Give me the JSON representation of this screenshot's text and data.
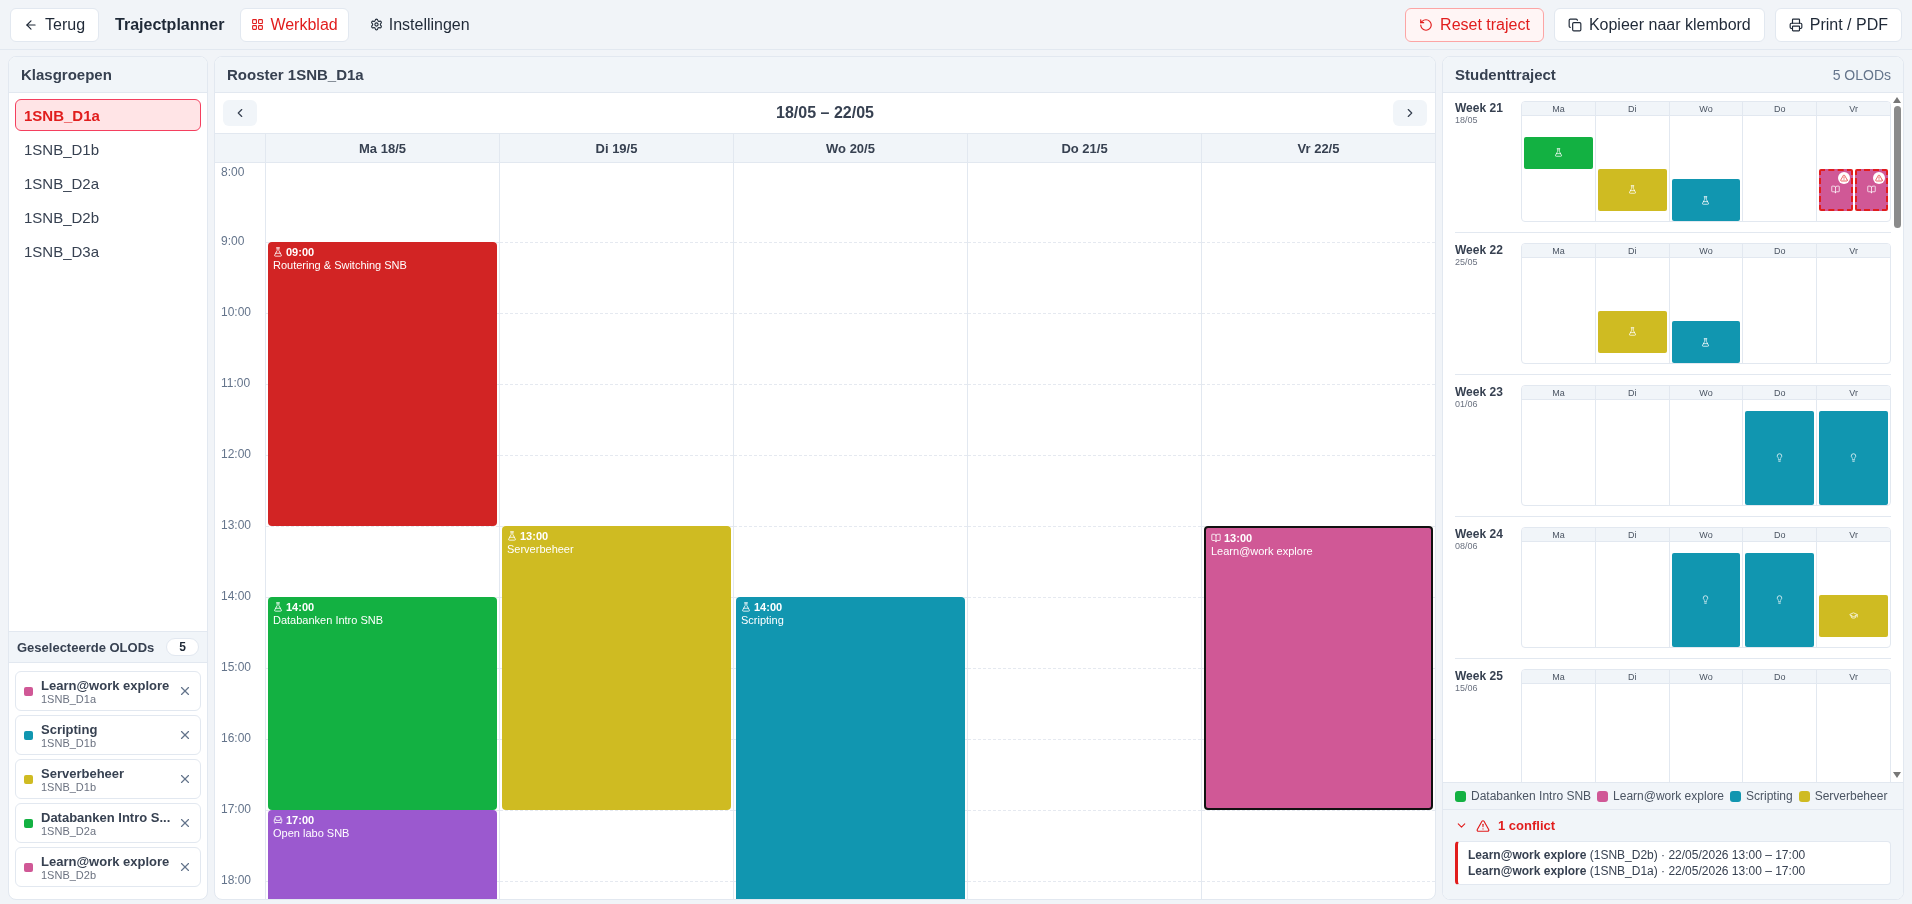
{
  "toolbar": {
    "back": "Terug",
    "title": "Trajectplanner",
    "tabs": [
      {
        "label": "Werkblad",
        "selected": true,
        "kind": "grid"
      },
      {
        "label": "Instellingen",
        "selected": false,
        "kind": "gear"
      }
    ],
    "actions": [
      {
        "label": "Reset traject",
        "kind": "reset"
      },
      {
        "label": "Kopieer naar klembord",
        "kind": "copy"
      },
      {
        "label": "Print / PDF",
        "kind": "print"
      }
    ]
  },
  "groups": {
    "title": "Klasgroepen",
    "items": [
      {
        "label": "1SNB_D1a",
        "selected": true
      },
      {
        "label": "1SNB_D1b",
        "selected": false
      },
      {
        "label": "1SNB_D2a",
        "selected": false
      },
      {
        "label": "1SNB_D2b",
        "selected": false
      },
      {
        "label": "1SNB_D3a",
        "selected": false
      }
    ]
  },
  "selected_olods": {
    "title": "Geselecteerde OLODs",
    "count": "5",
    "items": [
      {
        "name": "Learn@work explore",
        "group": "1SNB_D1a",
        "color": "#d05896"
      },
      {
        "name": "Scripting",
        "group": "1SNB_D1b",
        "color": "#1196b0"
      },
      {
        "name": "Serverbeheer",
        "group": "1SNB_D1b",
        "color": "#cfbb22"
      },
      {
        "name": "Databanken Intro S...",
        "group": "1SNB_D2a",
        "color": "#13b142"
      },
      {
        "name": "Learn@work explore",
        "group": "1SNB_D2b",
        "color": "#d05896"
      }
    ]
  },
  "schedule": {
    "title": "Rooster 1SNB_D1a",
    "range": "18/05 – 22/05",
    "hours": [
      "8:00",
      "9:00",
      "10:00",
      "11:00",
      "12:00",
      "13:00",
      "14:00",
      "15:00",
      "16:00",
      "17:00",
      "18:00"
    ],
    "days": [
      {
        "label": "Ma 18/5",
        "slots": [
          {
            "kind": "empty"
          },
          {
            "kind": "lab",
            "time": "09:00",
            "title": "Routering & Switching SNB",
            "color": "#d22424",
            "selected": false
          },
          {
            "kind": "cont"
          },
          {
            "kind": "cont"
          },
          {
            "kind": "cont"
          },
          {
            "kind": "empty"
          },
          {
            "kind": "lab",
            "time": "14:00",
            "title": "Databanken Intro SNB",
            "color": "#13b142",
            "selected": false
          },
          {
            "kind": "cont"
          },
          {
            "kind": "cont"
          },
          {
            "kind": "chair",
            "time": "17:00",
            "title": "Open labo SNB",
            "color": "#9b59cf",
            "selected": false
          },
          {
            "kind": "cont"
          }
        ]
      },
      {
        "label": "Di 19/5",
        "slots": [
          {
            "kind": "empty"
          },
          {
            "kind": "empty"
          },
          {
            "kind": "empty"
          },
          {
            "kind": "empty"
          },
          {
            "kind": "empty"
          },
          {
            "kind": "lab",
            "time": "13:00",
            "title": "Serverbeheer",
            "color": "#cfbb22",
            "selected": false
          },
          {
            "kind": "cont"
          },
          {
            "kind": "cont"
          },
          {
            "kind": "cont"
          }
        ]
      },
      {
        "label": "Wo 20/5",
        "slots": [
          {
            "kind": "empty"
          },
          {
            "kind": "empty"
          },
          {
            "kind": "empty"
          },
          {
            "kind": "empty"
          },
          {
            "kind": "empty"
          },
          {
            "kind": "empty"
          },
          {
            "kind": "lab",
            "time": "14:00",
            "title": "Scripting",
            "color": "#1196b0",
            "selected": false
          },
          {
            "kind": "cont"
          },
          {
            "kind": "cont"
          },
          {
            "kind": "cont"
          },
          {
            "kind": "cont"
          }
        ]
      },
      {
        "label": "Do 21/5"
      },
      {
        "label": "Vr 22/5",
        "slots": [
          {
            "kind": "empty"
          },
          {
            "kind": "empty"
          },
          {
            "kind": "empty"
          },
          {
            "kind": "empty"
          },
          {
            "kind": "empty"
          },
          {
            "kind": "book",
            "time": "13:00",
            "title": "Learn@work explore",
            "color": "#d05896",
            "selected": true
          },
          {
            "kind": "cont"
          },
          {
            "kind": "cont"
          },
          {
            "kind": "cont"
          }
        ]
      }
    ]
  },
  "trajectory": {
    "title": "Studenttraject",
    "count": "5 OLODs",
    "weeks": [
      {
        "label": "Week 21",
        "date": "18/05",
        "days": [
          {
            "label": "Ma",
            "slots": [
              {
                "kind": "empty"
              },
              {
                "kind": "empty"
              },
              {
                "kind": "event",
                "blocks": [
                  {
                    "kind": "lab",
                    "color": "#13b142",
                    "conflict": false
                  }
                ]
              },
              {
                "kind": "cont"
              },
              {
                "kind": "cont"
              }
            ]
          },
          {
            "label": "Di",
            "slots": [
              {
                "kind": "empty"
              },
              {
                "kind": "empty"
              },
              {
                "kind": "empty"
              },
              {
                "kind": "empty"
              },
              {
                "kind": "empty"
              },
              {
                "kind": "event",
                "blocks": [
                  {
                    "kind": "lab",
                    "color": "#cfbb22",
                    "conflict": false
                  }
                ]
              },
              {
                "kind": "cont"
              },
              {
                "kind": "cont"
              },
              {
                "kind": "cont"
              }
            ]
          },
          {
            "label": "Wo",
            "slots": [
              {
                "kind": "empty"
              },
              {
                "kind": "empty"
              },
              {
                "kind": "empty"
              },
              {
                "kind": "empty"
              },
              {
                "kind": "empty"
              },
              {
                "kind": "empty"
              },
              {
                "kind": "event",
                "blocks": [
                  {
                    "kind": "lab",
                    "color": "#1196b0",
                    "conflict": false
                  }
                ]
              },
              {
                "kind": "cont"
              },
              {
                "kind": "cont"
              },
              {
                "kind": "cont"
              }
            ]
          },
          {
            "label": "Do"
          },
          {
            "label": "Vr",
            "slots": [
              {
                "kind": "empty"
              },
              {
                "kind": "empty"
              },
              {
                "kind": "empty"
              },
              {
                "kind": "empty"
              },
              {
                "kind": "empty"
              },
              {
                "kind": "event",
                "blocks": [
                  {
                    "kind": "book",
                    "color": "#d05896",
                    "conflict": true
                  },
                  {
                    "kind": "book",
                    "color": "#d05896",
                    "conflict": true
                  }
                ]
              },
              {
                "kind": "cont"
              },
              {
                "kind": "cont"
              },
              {
                "kind": "cont"
              }
            ]
          }
        ]
      },
      {
        "label": "Week 22",
        "date": "25/05",
        "days": [
          {
            "label": "Ma"
          },
          {
            "label": "Di",
            "slots": [
              {
                "kind": "empty"
              },
              {
                "kind": "empty"
              },
              {
                "kind": "empty"
              },
              {
                "kind": "empty"
              },
              {
                "kind": "empty"
              },
              {
                "kind": "event",
                "blocks": [
                  {
                    "kind": "lab",
                    "color": "#cfbb22",
                    "conflict": false
                  }
                ]
              },
              {
                "kind": "cont"
              },
              {
                "kind": "cont"
              },
              {
                "kind": "cont"
              }
            ]
          },
          {
            "label": "Wo",
            "slots": [
              {
                "kind": "empty"
              },
              {
                "kind": "empty"
              },
              {
                "kind": "empty"
              },
              {
                "kind": "empty"
              },
              {
                "kind": "empty"
              },
              {
                "kind": "empty"
              },
              {
                "kind": "event",
                "blocks": [
                  {
                    "kind": "lab",
                    "color": "#1196b0",
                    "conflict": false
                  }
                ]
              },
              {
                "kind": "cont"
              },
              {
                "kind": "cont"
              },
              {
                "kind": "cont"
              }
            ]
          },
          {
            "label": "Do"
          },
          {
            "label": "Vr"
          }
        ]
      },
      {
        "label": "Week 23",
        "date": "01/06",
        "days": [
          {
            "label": "Ma"
          },
          {
            "label": "Di"
          },
          {
            "label": "Wo"
          },
          {
            "label": "Do",
            "slots": [
              {
                "kind": "empty"
              },
              {
                "kind": "event",
                "blocks": [
                  {
                    "kind": "idea",
                    "color": "#1196b0",
                    "conflict": false
                  }
                ]
              },
              {
                "kind": "cont"
              },
              {
                "kind": "cont"
              },
              {
                "kind": "cont"
              },
              {
                "kind": "cont"
              },
              {
                "kind": "cont"
              },
              {
                "kind": "cont"
              },
              {
                "kind": "cont"
              },
              {
                "kind": "cont"
              }
            ]
          },
          {
            "label": "Vr",
            "slots": [
              {
                "kind": "empty"
              },
              {
                "kind": "event",
                "blocks": [
                  {
                    "kind": "idea",
                    "color": "#1196b0",
                    "conflict": false
                  }
                ]
              },
              {
                "kind": "cont"
              },
              {
                "kind": "cont"
              },
              {
                "kind": "cont"
              },
              {
                "kind": "cont"
              },
              {
                "kind": "cont"
              },
              {
                "kind": "cont"
              },
              {
                "kind": "cont"
              },
              {
                "kind": "cont"
              }
            ]
          }
        ]
      },
      {
        "label": "Week 24",
        "date": "08/06",
        "days": [
          {
            "label": "Ma"
          },
          {
            "label": "Di"
          },
          {
            "label": "Wo",
            "slots": [
              {
                "kind": "empty"
              },
              {
                "kind": "event",
                "blocks": [
                  {
                    "kind": "idea",
                    "color": "#1196b0",
                    "conflict": false
                  }
                ]
              },
              {
                "kind": "cont"
              },
              {
                "kind": "cont"
              },
              {
                "kind": "cont"
              },
              {
                "kind": "cont"
              },
              {
                "kind": "cont"
              },
              {
                "kind": "cont"
              },
              {
                "kind": "cont"
              },
              {
                "kind": "cont"
              }
            ]
          },
          {
            "label": "Do",
            "slots": [
              {
                "kind": "empty"
              },
              {
                "kind": "event",
                "blocks": [
                  {
                    "kind": "idea",
                    "color": "#1196b0",
                    "conflict": false
                  }
                ]
              },
              {
                "kind": "cont"
              },
              {
                "kind": "cont"
              },
              {
                "kind": "cont"
              },
              {
                "kind": "cont"
              },
              {
                "kind": "cont"
              },
              {
                "kind": "cont"
              },
              {
                "kind": "cont"
              },
              {
                "kind": "cont"
              }
            ]
          },
          {
            "label": "Vr",
            "slots": [
              {
                "kind": "empty"
              },
              {
                "kind": "empty"
              },
              {
                "kind": "empty"
              },
              {
                "kind": "empty"
              },
              {
                "kind": "empty"
              },
              {
                "kind": "event",
                "blocks": [
                  {
                    "kind": "grad",
                    "color": "#cfbb22",
                    "conflict": false
                  }
                ]
              },
              {
                "kind": "cont"
              },
              {
                "kind": "cont"
              },
              {
                "kind": "cont"
              }
            ]
          }
        ]
      },
      {
        "label": "Week 25",
        "date": "15/06",
        "days": [
          {
            "label": "Ma"
          },
          {
            "label": "Di"
          },
          {
            "label": "Wo"
          },
          {
            "label": "Do"
          },
          {
            "label": "Vr"
          }
        ]
      }
    ],
    "legend": [
      {
        "label": "Databanken Intro SNB",
        "color": "#13b142"
      },
      {
        "label": "Learn@work explore",
        "color": "#d05896"
      },
      {
        "label": "Scripting",
        "color": "#1196b0"
      },
      {
        "label": "Serverbeheer",
        "color": "#cfbb22"
      }
    ],
    "conflicts": {
      "title": "1 conflict",
      "expanded": true,
      "lines": [
        "**Learn@work explore** (1SNB_D2b) · 22/05/2026 13:00 – 17:00",
        "**Learn@work explore** (1SNB_D1a) · 22/05/2026 13:00 – 17:00"
      ]
    }
  }
}
